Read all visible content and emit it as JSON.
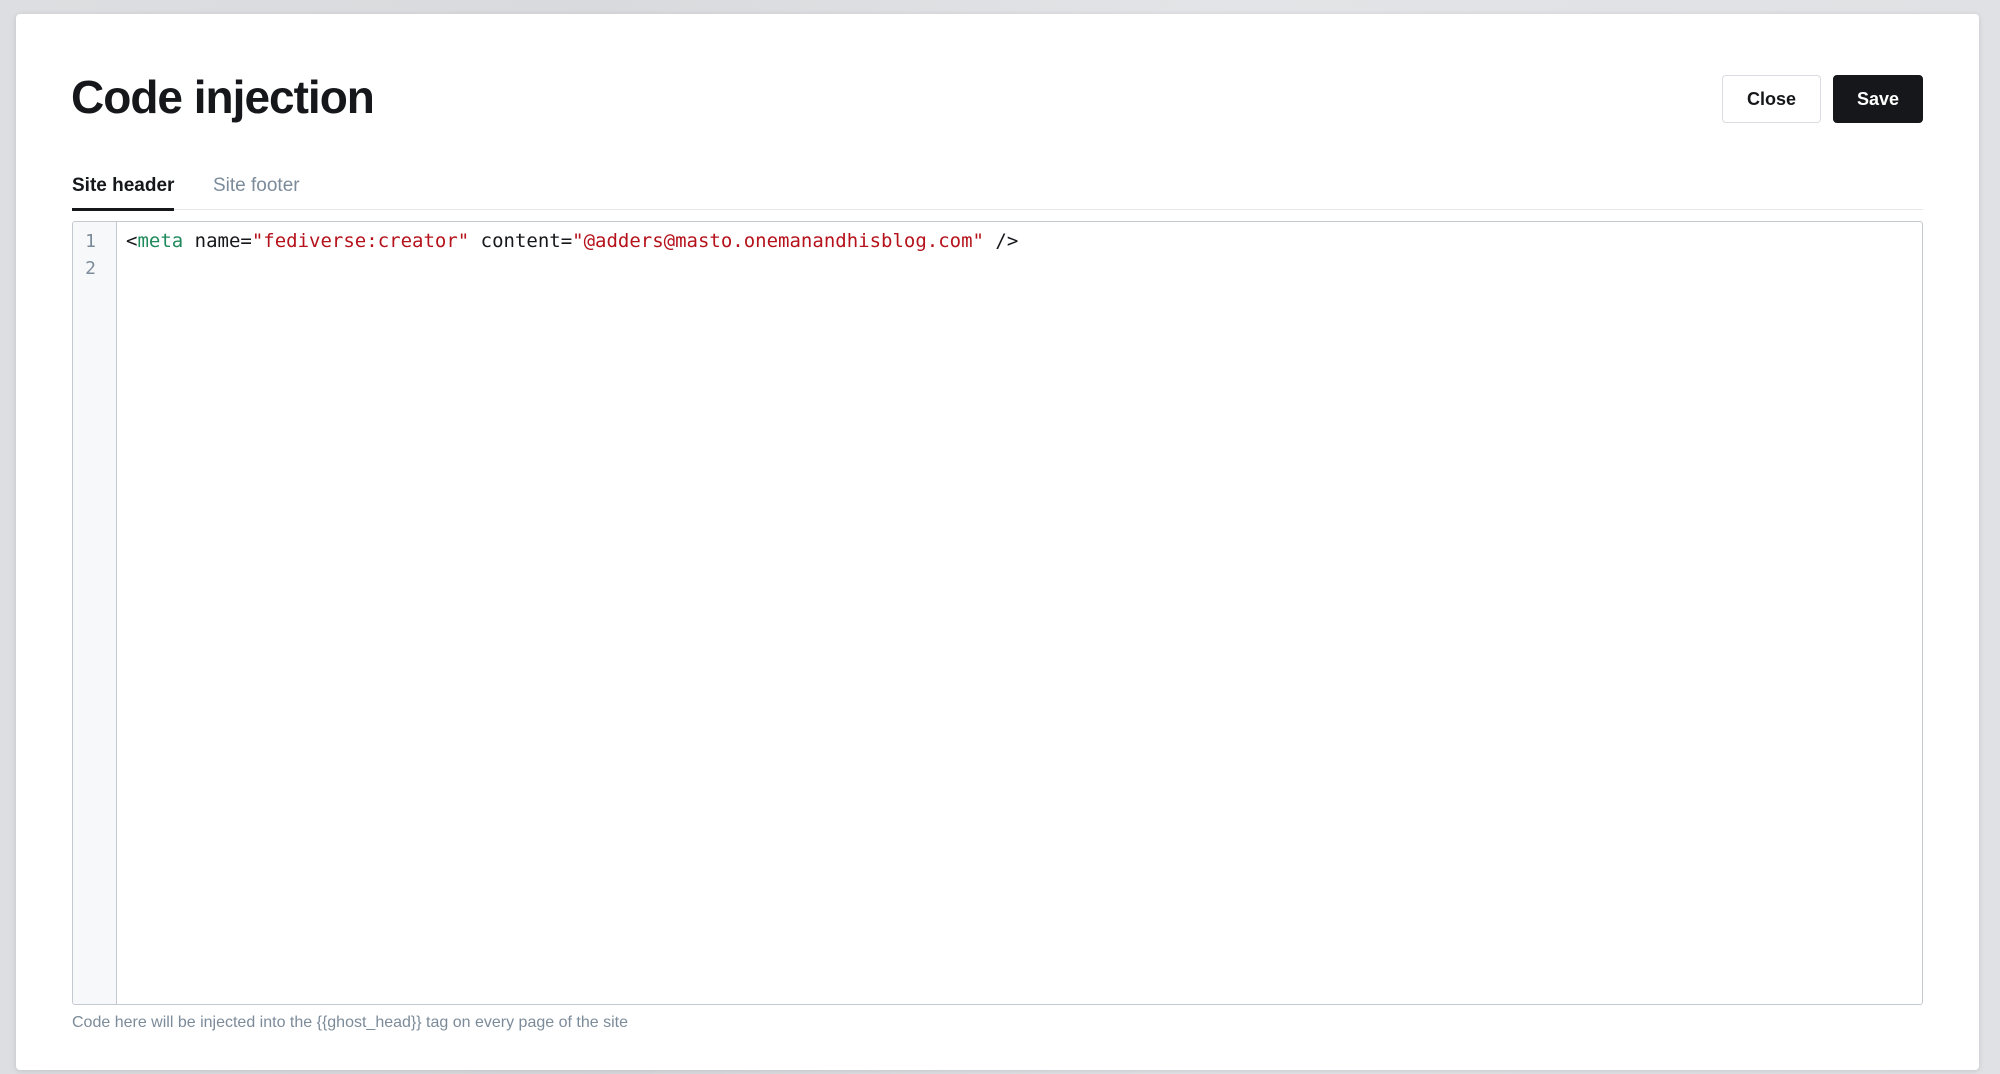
{
  "modal": {
    "title": "Code injection",
    "close_label": "Close",
    "save_label": "Save"
  },
  "tabs": [
    {
      "label": "Site header",
      "active": true
    },
    {
      "label": "Site footer",
      "active": false
    }
  ],
  "editor": {
    "line_numbers": [
      "1",
      "2"
    ],
    "line1": {
      "open_bracket": "<",
      "tag": "meta",
      "attr1": " name=",
      "val1": "\"fediverse:creator\"",
      "attr2": " content=",
      "val2": "\"@adders@masto.onemanandhisblog.com\"",
      "close": " />"
    },
    "line2": ""
  },
  "hint": "Code here will be injected into the {{ghost_head}} tag on every page of the site",
  "colors": {
    "primary_button": "#15171a",
    "tag_token": "#1f8a5b",
    "string_token": "#b5121b",
    "muted_text": "#7c8b9a"
  }
}
